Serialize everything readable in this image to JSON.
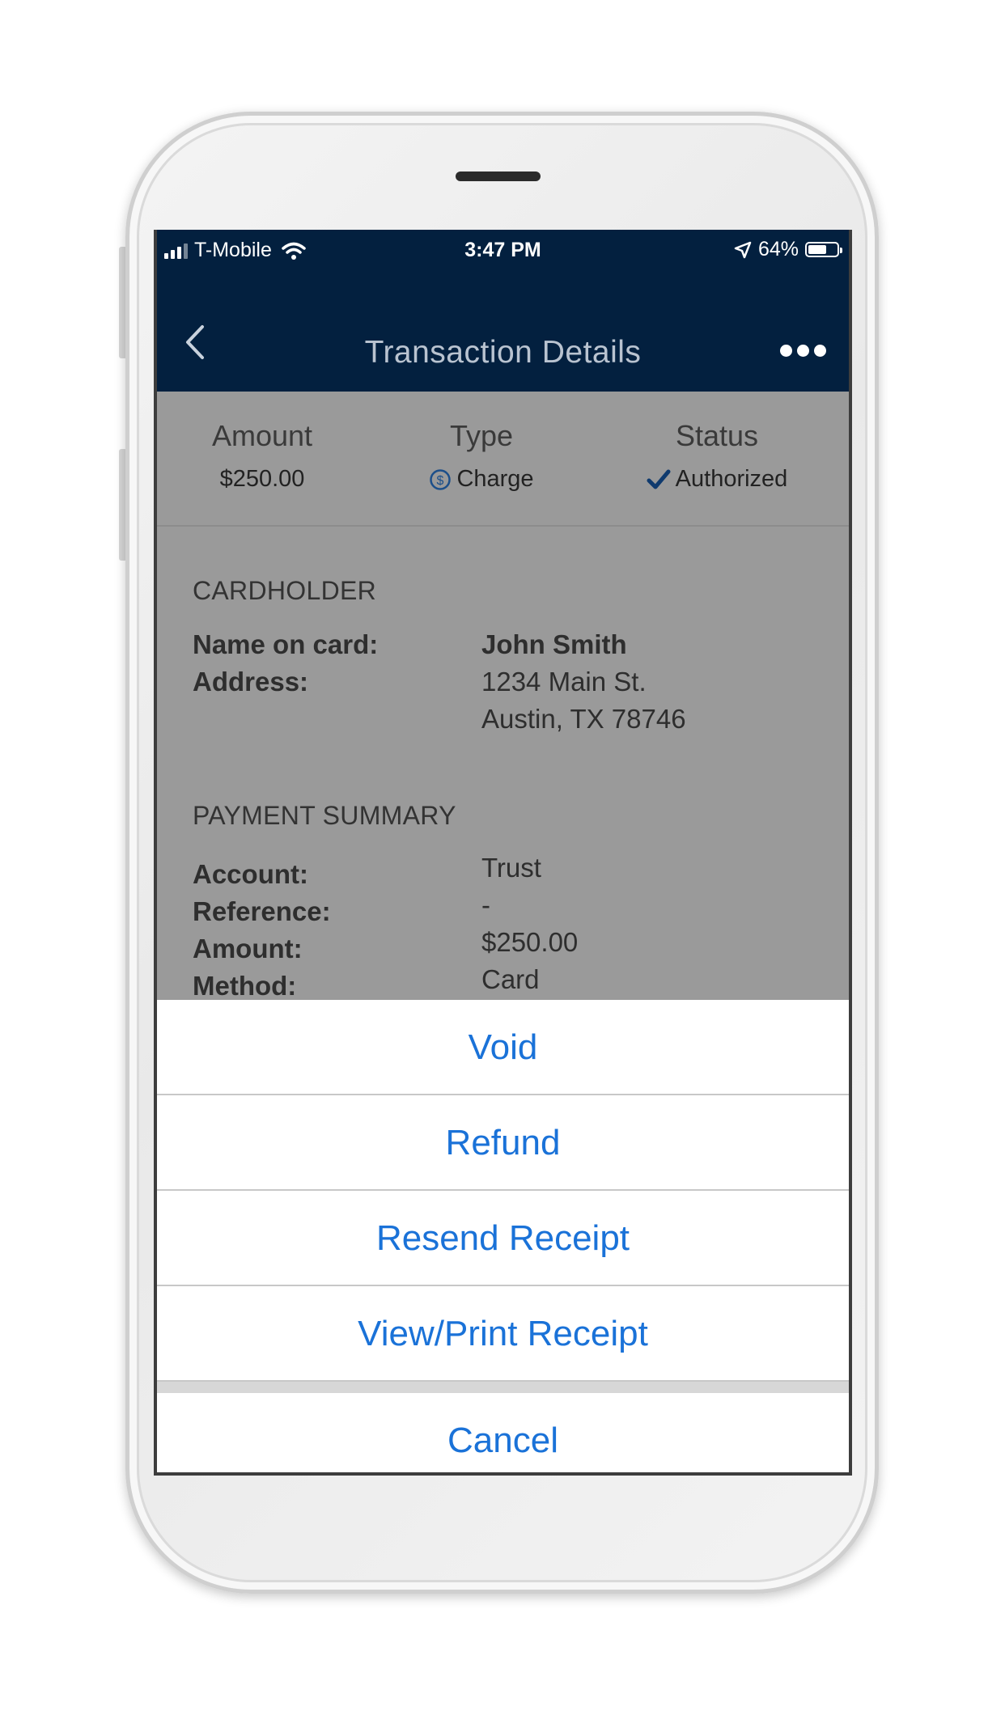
{
  "status_bar": {
    "carrier": "T-Mobile",
    "time": "3:47 PM",
    "battery_percent": "64%",
    "battery_level": 0.64
  },
  "nav": {
    "title": "Transaction Details",
    "back_icon": "chevron-left-icon",
    "more_icon": "more-dots-icon"
  },
  "summary": {
    "amount_label": "Amount",
    "amount_value": "$250.00",
    "type_label": "Type",
    "type_value": "Charge",
    "status_label": "Status",
    "status_value": "Authorized"
  },
  "cardholder": {
    "section_title": "CARDHOLDER",
    "name_label": "Name on card:",
    "name_value": "John Smith",
    "address_label": "Address:",
    "address_line1": "1234 Main St.",
    "address_line2": "Austin, TX 78746"
  },
  "payment_summary": {
    "section_title": "PAYMENT SUMMARY",
    "account_label": "Account:",
    "account_value": "Trust",
    "reference_label": "Reference:",
    "reference_value": "-",
    "amount_label": "Amount:",
    "amount_value": "$250.00",
    "method_label": "Method:",
    "method_value": "Card"
  },
  "action_sheet": {
    "void": "Void",
    "refund": "Refund",
    "resend_receipt": "Resend Receipt",
    "view_print_receipt": "View/Print Receipt",
    "cancel": "Cancel"
  },
  "colors": {
    "header_bg": "#03203f",
    "action_blue": "#1a72d8",
    "check_blue": "#0f3a6e",
    "dim_overlay": "#9a9a9a"
  }
}
